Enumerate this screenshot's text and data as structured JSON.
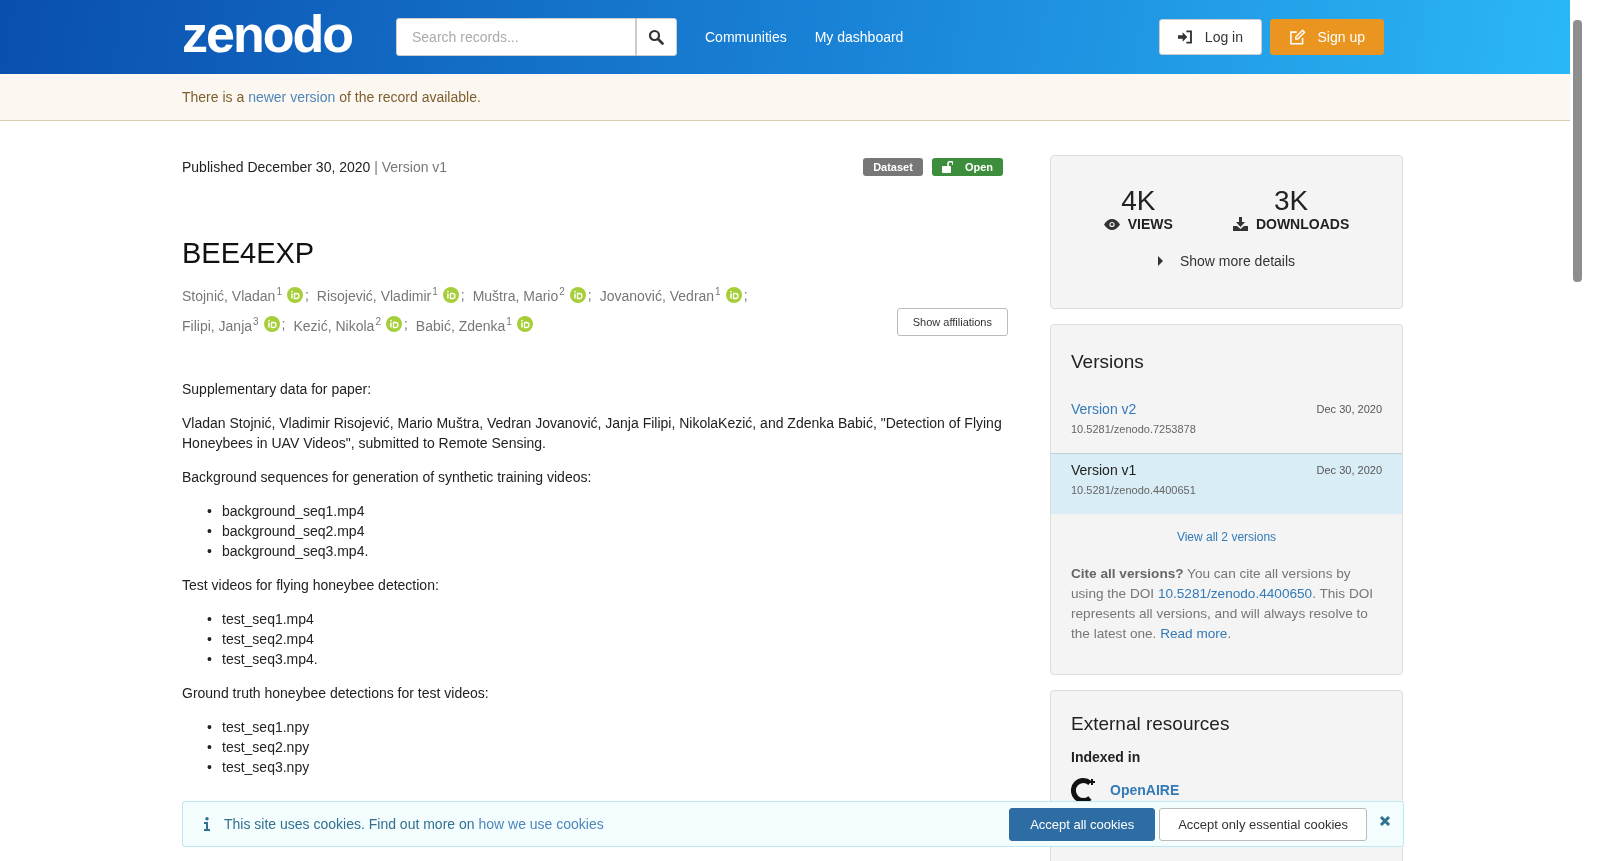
{
  "header": {
    "logo": "zenodo",
    "search": {
      "placeholder": "Search records..."
    },
    "nav": [
      "Communities",
      "My dashboard"
    ],
    "login": "Log in",
    "signup": "Sign up"
  },
  "notice": {
    "before": "There is a",
    "link": "newer version",
    "after": "of the record available."
  },
  "record": {
    "published": "Published December 30, 2020",
    "version": "| Version v1",
    "badges": [
      {
        "label": "Dataset",
        "kind": "type"
      },
      {
        "label": "Open",
        "kind": "access"
      }
    ],
    "title": "BEE4EXP",
    "authors": [
      {
        "name": "Stojnić, Vladan",
        "sup": "1",
        "separator": ";"
      },
      {
        "name": "Risojević, Vladimir",
        "sup": "1",
        "separator": ";"
      },
      {
        "name": "Muštra, Mario",
        "sup": "2",
        "separator": ";"
      },
      {
        "name": "Jovanović, Vedran",
        "sup": "1",
        "separator": ";"
      },
      {
        "name": "Filipi, Janja",
        "sup": "3",
        "separator": ";"
      },
      {
        "name": "Kezić, Nikola",
        "sup": "2",
        "separator": ";"
      },
      {
        "name": "Babić, Zdenka",
        "sup": "1"
      }
    ],
    "show_affiliations": "Show affiliations",
    "description": [
      {
        "kind": "p",
        "text": "Supplementary data for paper:"
      },
      {
        "kind": "p",
        "text": "Vladan Stojnić, Vladimir Risojević, Mario Muštra, Vedran Jovanović, Janja Filipi, NikolaKezić, and Zdenka Babić, \"Detection of Flying Honeybees in UAV Videos\", submitted to Remote Sensing."
      },
      {
        "kind": "p",
        "text": "Background sequences for generation of synthetic training videos:"
      },
      {
        "kind": "ul",
        "marker": "•",
        "items": [
          "background_seq1.mp4",
          "background_seq2.mp4",
          "background_seq3.mp4."
        ]
      },
      {
        "kind": "p",
        "text": "Test videos for flying honeybee detection:"
      },
      {
        "kind": "ul",
        "marker": "•",
        "items": [
          "test_seq1.mp4",
          "test_seq2.mp4",
          "test_seq3.mp4."
        ]
      },
      {
        "kind": "p",
        "text": "Ground truth honeybee detections for test videos:"
      },
      {
        "kind": "ul",
        "marker": "•",
        "items": [
          "test_seq1.npy",
          "test_seq2.npy",
          "test_seq3.npy"
        ]
      }
    ]
  },
  "stats": {
    "views": "4K",
    "views_label": "VIEWS",
    "downloads": "3K",
    "downloads_label": "DOWNLOADS",
    "more": "Show more details"
  },
  "versions": {
    "title": "Versions",
    "items": [
      {
        "label": "Version v2",
        "date": "Dec 30, 2020",
        "doi": "10.5281/zenodo.7253878",
        "selected": false
      },
      {
        "label": "Version v1",
        "date": "Dec 30, 2020",
        "doi": "10.5281/zenodo.4400651",
        "selected": true
      }
    ],
    "view_all": "View all 2 versions",
    "cite": {
      "bold": "Cite all versions?",
      "before": "You can cite all versions by using the DOI",
      "doi": "10.5281/zenodo.4400650",
      "middle": ". This DOI represents all versions, and will always resolve to the latest one.",
      "read_more": "Read more",
      "end": "."
    }
  },
  "external": {
    "title": "External resources",
    "indexed": "Indexed in",
    "name": "OpenAIRE"
  },
  "cookies": {
    "text": "This site uses cookies. Find out more on",
    "link": "how we use cookies",
    "accept_all": "Accept all cookies",
    "accept_essential": "Accept only essential cookies"
  }
}
